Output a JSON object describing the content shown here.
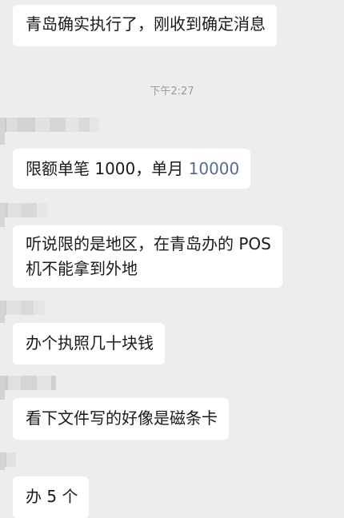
{
  "timestamp": "下午2:27",
  "messages": [
    {
      "text": "青岛确实执行了，刚收到确定消息"
    },
    {
      "text": "限额单笔 1000，单月 ",
      "link": "10000"
    },
    {
      "line1": "听说限的是地区，在青岛办的 POS",
      "line2": "机不能拿到外地"
    },
    {
      "text": "办个执照几十块钱"
    },
    {
      "text": "看下文件写的好像是磁条卡"
    },
    {
      "text": "办 5 个"
    }
  ]
}
